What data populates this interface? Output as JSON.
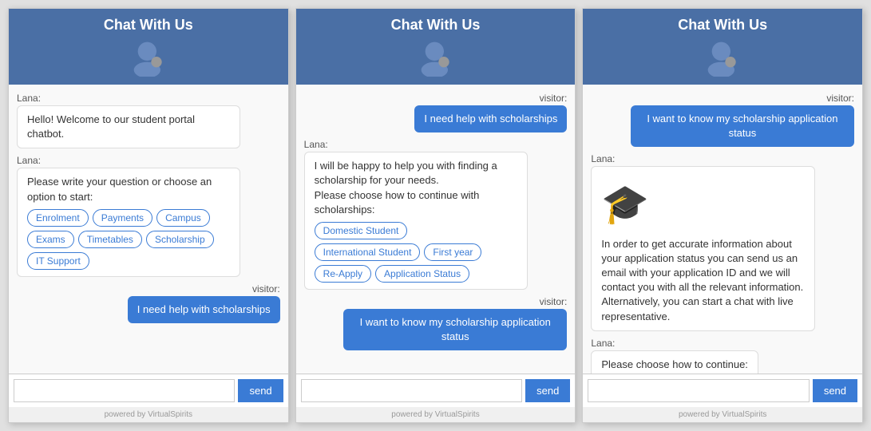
{
  "header": {
    "title": "Chat With Us",
    "powered_by": "powered by VirtualSpirits"
  },
  "chat1": {
    "messages": [
      {
        "sender": "Lana",
        "type": "lana",
        "text": "Hello! Welcome to our student portal chatbot."
      },
      {
        "sender": "Lana",
        "type": "lana-options",
        "text": "Please write your question or choose an option to start:",
        "options": [
          "Enrolment",
          "Payments",
          "Campus",
          "Exams",
          "Timetables",
          "Scholarship",
          "IT Support"
        ]
      },
      {
        "sender": "visitor",
        "type": "visitor",
        "text": "I need help with scholarships"
      }
    ],
    "input_placeholder": "",
    "send_label": "send"
  },
  "chat2": {
    "messages": [
      {
        "sender": "visitor",
        "type": "visitor",
        "text": "I need help with scholarships"
      },
      {
        "sender": "Lana",
        "type": "lana-options",
        "text": "I will be happy to help you with finding a scholarship for your needs.\nPlease choose how to continue with scholarships:",
        "options": [
          "Domestic Student",
          "International Student",
          "First year",
          "Re-Apply",
          "Application Status"
        ]
      },
      {
        "sender": "visitor",
        "type": "visitor",
        "text": "I want to know my scholarship application status"
      }
    ],
    "input_placeholder": "",
    "send_label": "send"
  },
  "chat3": {
    "messages": [
      {
        "sender": "visitor",
        "type": "visitor",
        "text": "I want to know my scholarship application status"
      },
      {
        "sender": "Lana",
        "type": "lana-grad",
        "text": "In order to get accurate information about your application status you can send us an email with your application ID and we will contact you with all the relevant information. Alternatively, you can start a chat with live representative."
      },
      {
        "sender": "Lana",
        "type": "lana-plain",
        "text": "Please choose how to continue:"
      }
    ],
    "input_placeholder": "",
    "send_label": "send"
  }
}
